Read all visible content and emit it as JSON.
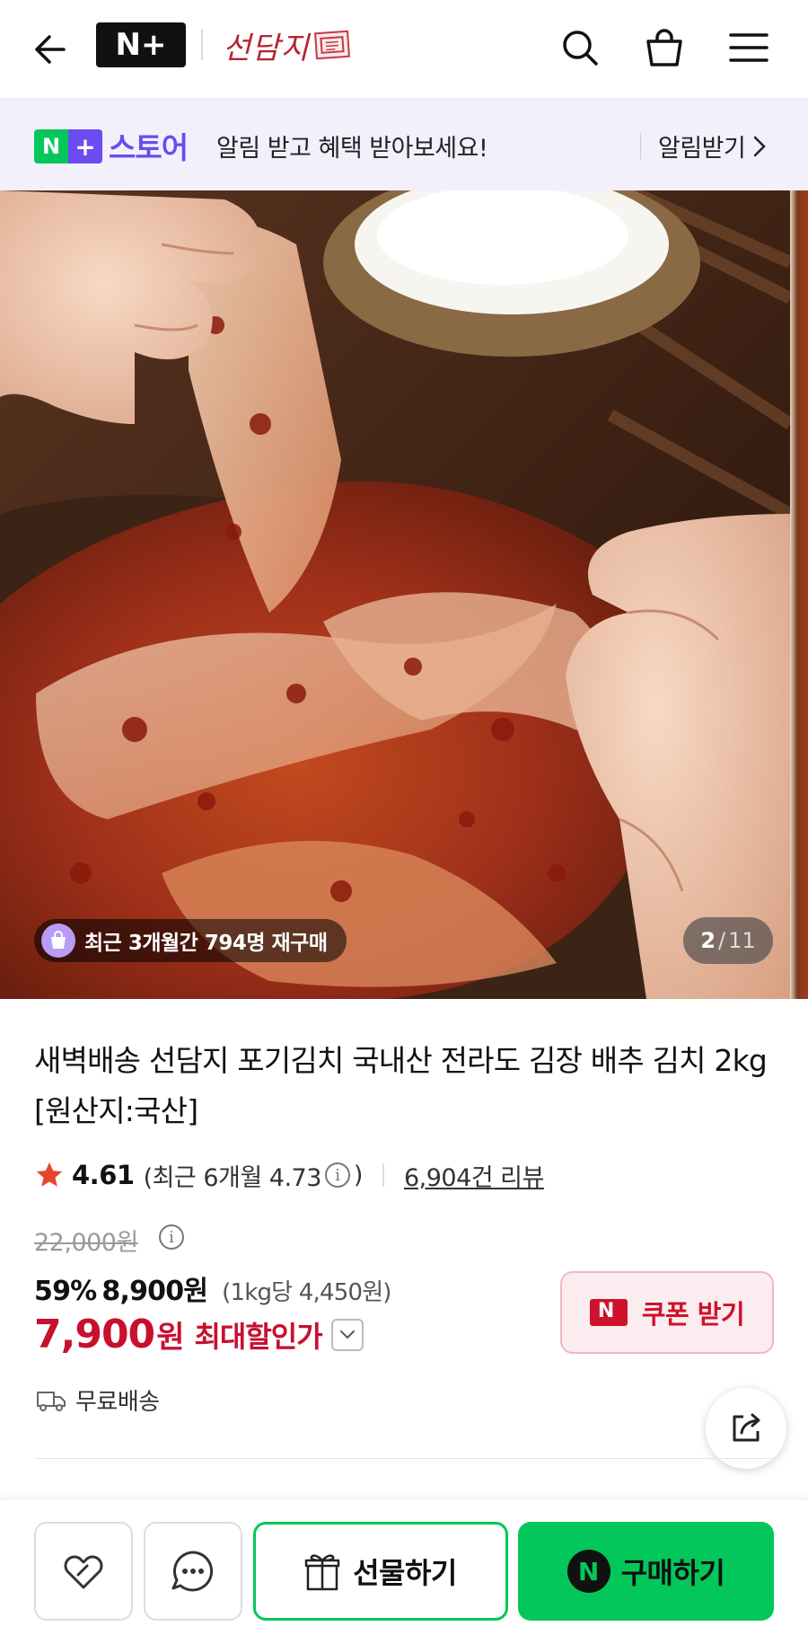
{
  "header": {
    "back_icon": "arrow-left-icon",
    "store_logo": "N+",
    "brand_name": "선담지",
    "icons": [
      "search-icon",
      "shopping-bag-icon",
      "menu-icon"
    ]
  },
  "promo_banner": {
    "logo_n": "N",
    "logo_plus": "+",
    "store_label": "스토어",
    "message": "알림 받고 혜택 받아보세요!",
    "cta": "알림받기",
    "colors": {
      "background": "#f3f0fc",
      "accent": "#6a4cf0",
      "green": "#03c75a"
    }
  },
  "hero": {
    "image_icon": "kimchi-photo",
    "repurchase_badge": "최근 3개월간 794명 재구매",
    "pager_current": "2",
    "pager_sep": "/",
    "pager_total": "11"
  },
  "product": {
    "title": "새벽배송 선담지 포기김치 국내산 전라도 김장 배추 김치 2kg [원산지:국산]",
    "rating_score": "4.61",
    "rating_recent_open": "(최근 6개월 4.73",
    "rating_recent_close": ")",
    "review_link": "6,904건 리뷰",
    "original_price": "22,000원",
    "discount_percent": "59%",
    "sale_price": "8,900원",
    "unit_price": "(1kg당 4,450원)",
    "max_discount_price": "7,900",
    "max_discount_won": "원",
    "max_discount_label": "최대할인가",
    "coupon_button": "쿠폰 받기",
    "shipping": "무료배송",
    "colors": {
      "sale": "#c8102e",
      "coupon_bg": "#fbecef",
      "star": "#e8452e"
    }
  },
  "bottom_bar": {
    "wishlist_icon": "heart-icon",
    "talk_icon": "chat-bubble-icon",
    "gift_button": "선물하기",
    "buy_button": "구매하기",
    "buy_n": "N",
    "colors": {
      "primary": "#03c75a"
    }
  }
}
